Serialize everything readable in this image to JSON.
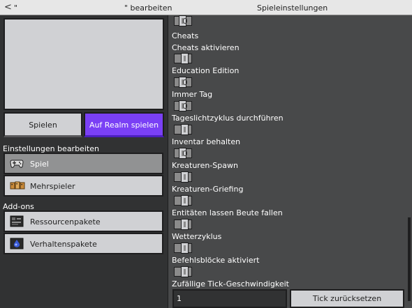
{
  "header": {
    "back_label": "<",
    "title_left": "\"",
    "title_mid": "\" bearbeiten",
    "title_right": "Spieleinstellungen"
  },
  "left": {
    "play_label": "Spielen",
    "realm_label": "Auf Realm spielen",
    "settings_heading": "Einstellungen bearbeiten",
    "menu": [
      {
        "label": "Spiel",
        "icon": "gamepad-icon",
        "active": true
      },
      {
        "label": "Mehrspieler",
        "icon": "multiplayer-icon",
        "active": false
      }
    ],
    "addons_heading": "Add-ons",
    "addons": [
      {
        "label": "Ressourcenpakete",
        "icon": "resource-pack-icon"
      },
      {
        "label": "Verhaltenspakete",
        "icon": "behavior-pack-icon"
      }
    ]
  },
  "settings": {
    "cheats_heading": "Cheats",
    "items": [
      {
        "label": "Cheats aktivieren",
        "on": true
      },
      {
        "label": "Education Edition",
        "on": false
      },
      {
        "label": "Immer Tag",
        "on": false
      },
      {
        "label": "Tageslichtzyklus durchführen",
        "on": true
      },
      {
        "label": "Inventar behalten",
        "on": false
      },
      {
        "label": "Kreaturen-Spawn",
        "on": true
      },
      {
        "label": "Kreaturen-Griefing",
        "on": true
      },
      {
        "label": "Entitäten lassen Beute fallen",
        "on": true
      },
      {
        "label": "Wetterzyklus",
        "on": true
      },
      {
        "label": "Befehlsblöcke aktiviert",
        "on": true
      }
    ],
    "tick_label": "Zufällige Tick-Geschwindigkeit",
    "tick_value": "1",
    "tick_reset_label": "Tick zurücksetzen"
  },
  "colors": {
    "accent": "#7a40f5",
    "panel_dark": "#313233",
    "panel_mid": "#48494a",
    "button_light": "#d0d1d4"
  }
}
